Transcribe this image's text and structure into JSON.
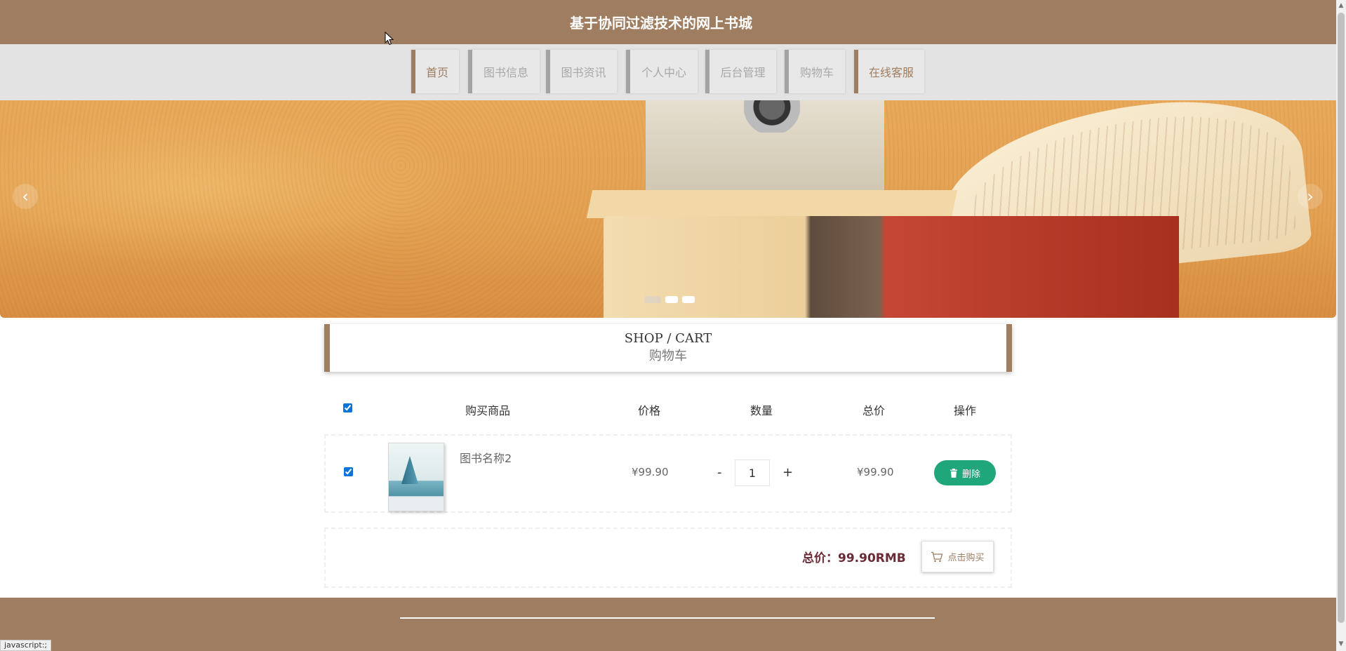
{
  "header": {
    "title": "基于协同过滤技术的网上书城"
  },
  "nav": {
    "items": [
      {
        "label": "首页",
        "active": true
      },
      {
        "label": "图书信息",
        "active": false
      },
      {
        "label": "图书资讯",
        "active": false
      },
      {
        "label": "个人中心",
        "active": false
      },
      {
        "label": "后台管理",
        "active": false
      },
      {
        "label": "购物车",
        "active": false
      },
      {
        "label": "在线客服",
        "active": true
      }
    ]
  },
  "banner": {
    "prev_glyph": "‹",
    "next_glyph": "›",
    "slide_count": 3,
    "active_slide": 1
  },
  "cart": {
    "heading_en": "SHOP / CART",
    "heading_cn": "购物车",
    "columns": {
      "product": "购买商品",
      "price": "价格",
      "quantity": "数量",
      "total": "总价",
      "action": "操作"
    },
    "select_all_checked": true,
    "items": [
      {
        "checked": true,
        "name": "图书名称2",
        "price": "¥99.90",
        "qty_minus": "-",
        "quantity": "1",
        "qty_plus": "+",
        "total": "¥99.90",
        "delete_label": "删除"
      }
    ],
    "summary": {
      "total_text": "总价：99.90RMB",
      "buy_label": "点击购买"
    }
  },
  "status_bar": {
    "text": "javascript:;"
  },
  "colors": {
    "brand": "#9e7d61",
    "delete": "#1fa67a",
    "total_text": "#6b2b35",
    "nav_bg": "#e3e3e3"
  },
  "icons": {
    "delete": "trash-icon",
    "buy": "cart-icon"
  }
}
